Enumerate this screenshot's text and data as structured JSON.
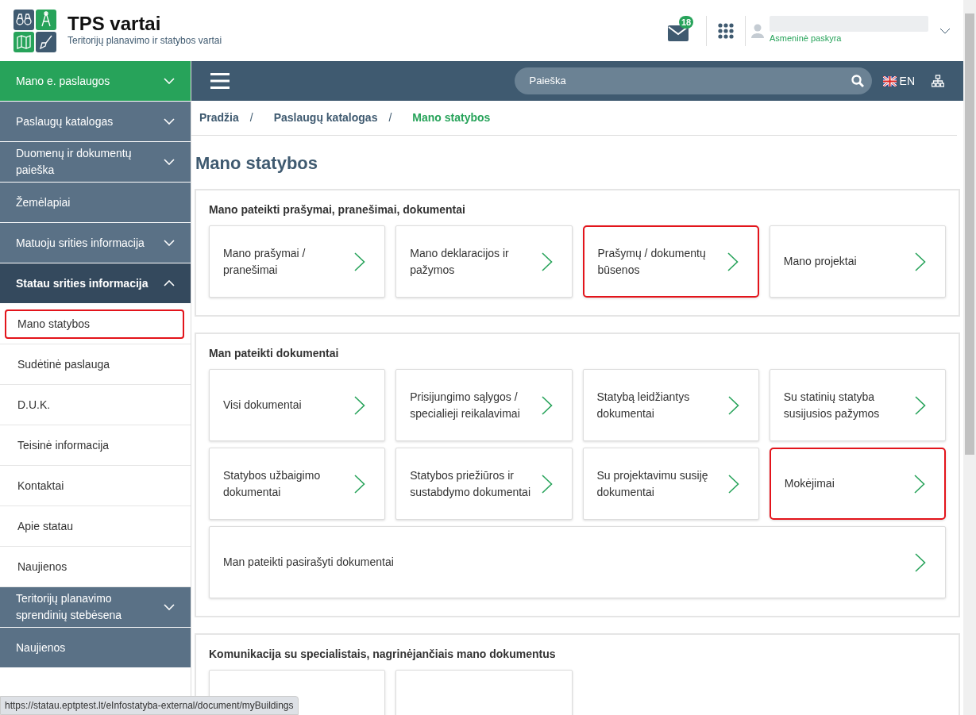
{
  "header": {
    "title": "TPS vartai",
    "subtitle": "Teritorijų planavimo ir statybos vartai",
    "mail_count": "18",
    "account_label": "Asmeninė paskyra"
  },
  "topbar": {
    "search": {
      "placeholder": "Paieška"
    },
    "language": "EN"
  },
  "sidebar": {
    "items": [
      {
        "label": "Mano e. paslaugos",
        "selected": true,
        "expandable": true,
        "expanded": false
      },
      {
        "label": "Paslaugų katalogas",
        "selected": false,
        "expandable": true,
        "expanded": false
      },
      {
        "label": "Duomenų ir dokumentų paieška",
        "selected": false,
        "expandable": true,
        "expanded": false
      },
      {
        "label": "Žemėlapiai",
        "selected": false,
        "expandable": false,
        "expanded": false
      },
      {
        "label": "Matuoju srities informacija",
        "selected": false,
        "expandable": true,
        "expanded": false
      },
      {
        "label": "Statau srities informacija",
        "selected": false,
        "expandable": true,
        "expanded": true,
        "children": [
          {
            "label": "Mano statybos",
            "highlighted": true
          },
          {
            "label": "Sudėtinė paslauga",
            "highlighted": false
          },
          {
            "label": "D.U.K.",
            "highlighted": false
          },
          {
            "label": "Teisinė informacija",
            "highlighted": false
          },
          {
            "label": "Kontaktai",
            "highlighted": false
          },
          {
            "label": "Apie statau",
            "highlighted": false
          },
          {
            "label": "Naujienos",
            "highlighted": false
          }
        ]
      },
      {
        "label": "Teritorijų planavimo sprendinių stebėsena",
        "selected": false,
        "expandable": true,
        "expanded": false
      },
      {
        "label": "Naujienos",
        "selected": false,
        "expandable": false,
        "expanded": false
      }
    ]
  },
  "breadcrumb": [
    {
      "label": "Pradžia",
      "selected": false,
      "separator": "/"
    },
    {
      "label": "Paslaugų katalogas",
      "selected": false,
      "separator": "/"
    },
    {
      "label": "Mano statybos",
      "selected": true
    }
  ],
  "page_title": "Mano statybos",
  "sections": [
    {
      "title": "Mano pateikti prašymai, pranešimai, dokumentai",
      "tiles": [
        {
          "label": "Mano prašymai / pranešimai",
          "highlighted": false,
          "kind": "normal"
        },
        {
          "label": "Mano deklaracijos ir pažymos",
          "highlighted": false,
          "kind": "normal"
        },
        {
          "label": "Prašymų / dokumentų būsenos",
          "highlighted": true,
          "kind": "normal"
        },
        {
          "label": "Mano projektai",
          "highlighted": false,
          "kind": "normal"
        }
      ]
    },
    {
      "title": "Man pateikti dokumentai",
      "tiles": [
        {
          "label": "Visi dokumentai",
          "highlighted": false,
          "kind": "normal"
        },
        {
          "label": "Prisijungimo sąlygos / specialieji reikalavimai",
          "highlighted": false,
          "kind": "normal"
        },
        {
          "label": "Statybą leidžiantys dokumentai",
          "highlighted": false,
          "kind": "normal"
        },
        {
          "label": "Su statinių statyba susijusios pažymos",
          "highlighted": false,
          "kind": "normal"
        },
        {
          "label": "Statybos užbaigimo dokumentai",
          "highlighted": false,
          "kind": "normal"
        },
        {
          "label": "Statybos priežiūros ir sustabdymo dokumentai",
          "highlighted": false,
          "kind": "normal"
        },
        {
          "label": "Su projektavimu susiję dokumentai",
          "highlighted": false,
          "kind": "normal"
        },
        {
          "label": "Mokėjimai",
          "highlighted": true,
          "kind": "normal"
        },
        {
          "label": "Man pateikti pasirašyti dokumentai",
          "highlighted": false,
          "kind": "wide"
        }
      ]
    },
    {
      "title": "Komunikacija su specialistais, nagrinėjančiais mano dokumentus",
      "tiles": [
        {
          "kind": "empty",
          "highlighted": false
        },
        {
          "kind": "empty",
          "highlighted": false
        }
      ]
    }
  ],
  "status_url": "https://statau.eptptest.lt/eInfostatyba-external/document/myBuildings"
}
